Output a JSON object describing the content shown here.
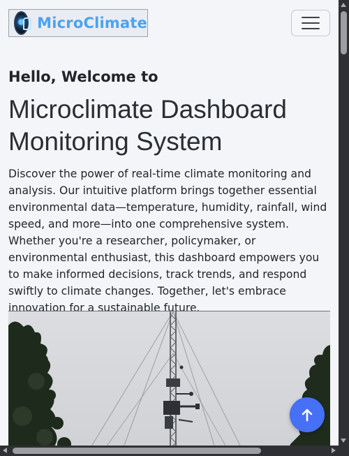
{
  "navbar": {
    "brand_text": "MicroClimate",
    "logo_icon": "globe-sensor-logo-icon",
    "toggle_icon": "hamburger-menu-icon"
  },
  "hero": {
    "greeting": "Hello, Welcome to",
    "title": "Microclimate Dashboard Monitoring System",
    "description": "Discover the power of real-time climate monitoring and analysis. Our intuitive platform brings together essential environmental data—temperature, humidity, rainfall, wind speed, and more—into one comprehensive system. Whether you're a researcher, policymaker, or environmental enthusiast, this dashboard empowers you to make informed decisions, track trends, and respond swiftly to climate changes. Together, let's embrace innovation for a sustainable future.",
    "image": "weather-tower-photo"
  },
  "back_to_top": {
    "icon": "arrow-up-icon",
    "color": "#4670f5"
  },
  "colors": {
    "background": "#f3f5f8",
    "brand": "#4aa3f0"
  }
}
